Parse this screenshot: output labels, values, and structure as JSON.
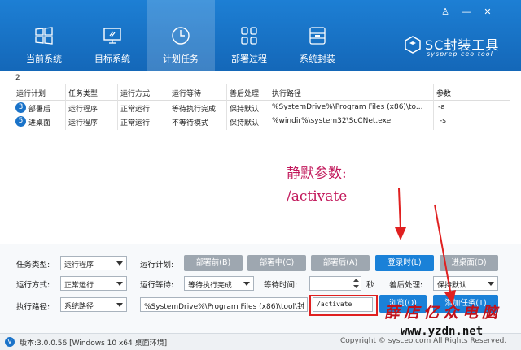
{
  "window": {
    "controls": [
      "♙",
      "—",
      "✕"
    ]
  },
  "tabs": [
    {
      "label": "当前系统",
      "icon": "windows-logo-icon",
      "active": false
    },
    {
      "label": "目标系统",
      "icon": "monitor-icon",
      "active": false
    },
    {
      "label": "计划任务",
      "icon": "clock-icon",
      "active": true
    },
    {
      "label": "部署过程",
      "icon": "grid-icon",
      "active": false
    },
    {
      "label": "系统封装",
      "icon": "package-icon",
      "active": false
    }
  ],
  "logo": {
    "title": "SC封装工具",
    "subtitle": "sysprep ceo tool"
  },
  "task_count": "2",
  "table": {
    "headers": [
      "运行计划",
      "任务类型",
      "运行方式",
      "运行等待",
      "善后处理",
      "执行路径",
      "参数"
    ],
    "rows": [
      {
        "badge": "3",
        "plan": "部署后",
        "type": "运行程序",
        "mode": "正常运行",
        "wait": "等待执行完成",
        "after": "保持默认",
        "path": "%SystemDrive%\\Program Files (x86)\\to...",
        "param": "-a"
      },
      {
        "badge": "5",
        "plan": "进桌面",
        "type": "运行程序",
        "mode": "正常运行",
        "wait": "不等待模式",
        "after": "保持默认",
        "path": "%windir%\\system32\\ScCNet.exe",
        "param": "-s"
      }
    ]
  },
  "annotation": {
    "line1": "静默参数:",
    "line2": "/activate"
  },
  "form": {
    "task_type_label": "任务类型:",
    "task_type_value": "运行程序",
    "run_mode_label": "运行方式:",
    "run_mode_value": "正常运行",
    "exec_path_label": "执行路径:",
    "exec_path_type_value": "系统路径",
    "plan_label": "运行计划:",
    "wait_label": "运行等待:",
    "wait_value": "等待执行完成",
    "wait_time_label": "等待时间:",
    "wait_time_unit": "秒",
    "after_label": "善后处理:",
    "after_value": "保持默认",
    "path_value": "%SystemDrive%\\Program Files (x86)\\tool\\封",
    "param_value": "/activate",
    "buttons": {
      "before_deploy": "部署前(B)",
      "during_deploy": "部署中(C)",
      "after_deploy": "部署后(A)",
      "login": "登录时(L)",
      "desktop": "进桌面(D)",
      "browse": "浏览(O)",
      "add_task": "添加任务(T)"
    }
  },
  "status": {
    "version": "版本:3.0.0.56 [Windows 10 x64 桌面环境]",
    "copyright": "Copyright © sysceo.com All Rights Reserved."
  },
  "watermark": {
    "cn": "薛店亿众电脑",
    "url": "www.yzdn.net"
  },
  "colors": {
    "topbar": "#1a75c9",
    "accent_blue": "#1a81d8",
    "annotation": "#c2185b",
    "watermark": "#c0111b",
    "highlight_box": "#e02020"
  }
}
